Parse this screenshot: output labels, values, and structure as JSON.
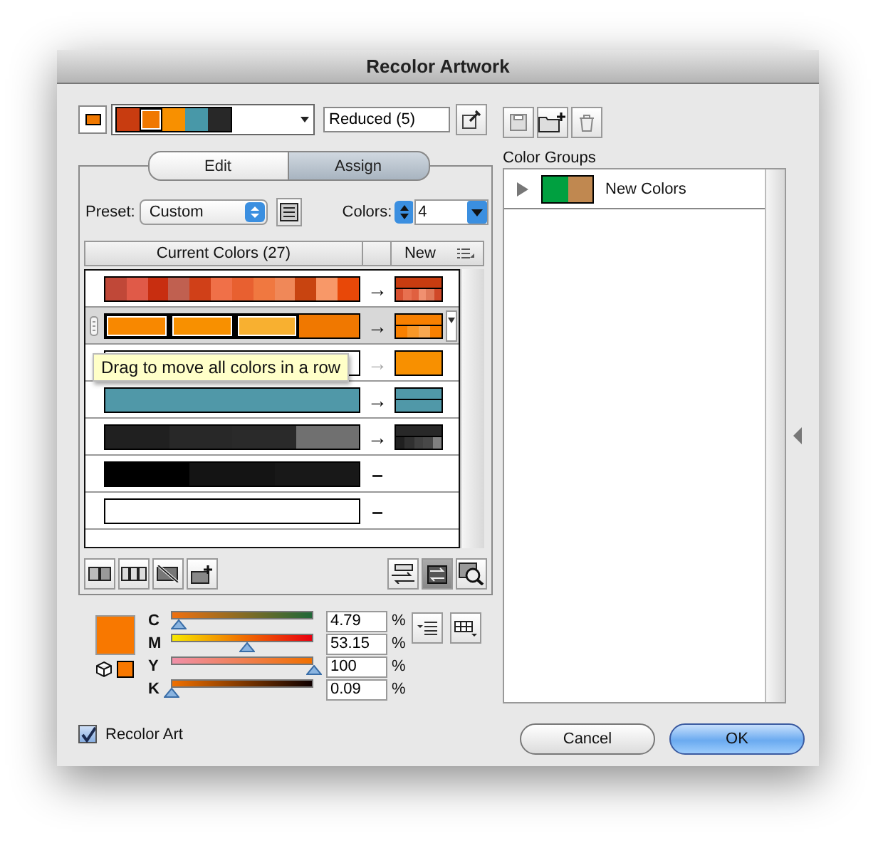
{
  "window": {
    "title": "Recolor Artwork"
  },
  "harmony": {
    "current_swatch": {
      "color": "#f07800"
    },
    "colors": [
      {
        "color": "#c83c10",
        "selected": false
      },
      {
        "color": "#f07800",
        "selected": true
      },
      {
        "color": "#f89000",
        "selected": false
      },
      {
        "color": "#4898a8",
        "selected": false
      },
      {
        "color": "#282828",
        "selected": false
      }
    ],
    "name_value": "Reduced (5)"
  },
  "tabs": [
    {
      "label": "Edit",
      "selected": false
    },
    {
      "label": "Assign",
      "selected": true
    }
  ],
  "preset": {
    "label": "Preset:",
    "value": "Custom"
  },
  "colors_count": {
    "label": "Colors:",
    "value": "4"
  },
  "table": {
    "columns": [
      "Current Colors (27)",
      "New"
    ],
    "rows": [
      {
        "selected": false,
        "arrow": "→",
        "muted": false,
        "current": [
          {
            "color": "#c04838",
            "framed": false
          },
          {
            "color": "#e05a48",
            "framed": false
          },
          {
            "color": "#c82e10",
            "framed": false
          },
          {
            "color": "#c06050",
            "framed": false
          },
          {
            "color": "#d04018",
            "framed": false
          },
          {
            "color": "#f07048",
            "framed": false
          },
          {
            "color": "#e86030",
            "framed": false
          },
          {
            "color": "#f07840",
            "framed": false
          },
          {
            "color": "#f08858",
            "framed": false
          },
          {
            "color": "#c84410",
            "framed": false
          },
          {
            "color": "#f89868",
            "framed": false
          },
          {
            "color": "#e84808",
            "framed": false
          }
        ],
        "new": [
          {
            "segments": [
              {
                "color": "#c83c10"
              }
            ]
          },
          {
            "segments": [
              {
                "color": "#d85030"
              },
              {
                "color": "#e87050"
              },
              {
                "color": "#e06040"
              },
              {
                "color": "#f09070"
              },
              {
                "color": "#e07858"
              },
              {
                "color": "#d04828"
              }
            ]
          }
        ]
      },
      {
        "selected": true,
        "arrow": "→",
        "muted": false,
        "current": [
          {
            "color": "#f88800",
            "framed": true
          },
          {
            "color": "#f89000",
            "framed": true
          },
          {
            "color": "#f8b030",
            "framed": true
          },
          {
            "color": "#f07800",
            "framed": false
          }
        ],
        "new": [
          {
            "segments": [
              {
                "color": "#f88000"
              }
            ]
          },
          {
            "segments": [
              {
                "color": "#f88000"
              },
              {
                "color": "#f89828"
              },
              {
                "color": "#f8a850"
              },
              {
                "color": "#f88000"
              }
            ]
          }
        ]
      },
      {
        "selected": false,
        "arrow": "→",
        "muted": true,
        "current": [
          {
            "color": "#ffffff",
            "framed": false
          }
        ],
        "new": [
          {
            "segments": [
              {
                "color": "#f89000"
              }
            ]
          }
        ]
      },
      {
        "selected": false,
        "arrow": "→",
        "muted": false,
        "current": [
          {
            "color": "#5098a8",
            "framed": false
          }
        ],
        "new": [
          {
            "segments": [
              {
                "color": "#5098a8"
              }
            ]
          },
          {
            "segments": [
              {
                "color": "#5098a8"
              }
            ]
          }
        ]
      },
      {
        "selected": false,
        "arrow": "→",
        "muted": false,
        "current": [
          {
            "color": "#202020",
            "framed": false
          },
          {
            "color": "#282828",
            "framed": false
          },
          {
            "color": "#2a2a2a",
            "framed": false
          },
          {
            "color": "#707070",
            "framed": false
          }
        ],
        "new": [
          {
            "segments": [
              {
                "color": "#282828"
              }
            ]
          },
          {
            "segments": [
              {
                "color": "#202020"
              },
              {
                "color": "#303030"
              },
              {
                "color": "#404040"
              },
              {
                "color": "#484848"
              },
              {
                "color": "#808080"
              }
            ]
          }
        ]
      },
      {
        "selected": false,
        "arrow": "–",
        "muted": false,
        "current": [
          {
            "color": "#000000",
            "framed": false
          },
          {
            "color": "#141414",
            "framed": false
          },
          {
            "color": "#181818",
            "framed": false
          }
        ]
      },
      {
        "selected": false,
        "arrow": "–",
        "muted": false,
        "current": [
          {
            "color": "#ffffff",
            "framed": false
          }
        ]
      }
    ]
  },
  "tooltip": "Drag to move all colors in a row",
  "editor": {
    "preview": {
      "color": "#f87800"
    },
    "sliders": [
      {
        "label": "C",
        "level": 0.048,
        "value": "4.79",
        "unit": "%"
      },
      {
        "label": "M",
        "level": 0.53,
        "value": "53.15",
        "unit": "%"
      },
      {
        "label": "Y",
        "level": 1.0,
        "value": "100",
        "unit": "%"
      },
      {
        "label": "K",
        "level": 0.001,
        "value": "0.09",
        "unit": "%"
      }
    ]
  },
  "recolor_art": {
    "label": "Recolor Art",
    "checked": true
  },
  "color_groups": {
    "label": "Color Groups",
    "items": [
      {
        "name": "New Colors",
        "expanded": false,
        "colors": [
          {
            "color": "#00a040"
          },
          {
            "color": "#c08850"
          }
        ]
      }
    ]
  },
  "buttons": [
    {
      "label": "Cancel",
      "default": false
    },
    {
      "label": "OK",
      "default": true
    }
  ]
}
